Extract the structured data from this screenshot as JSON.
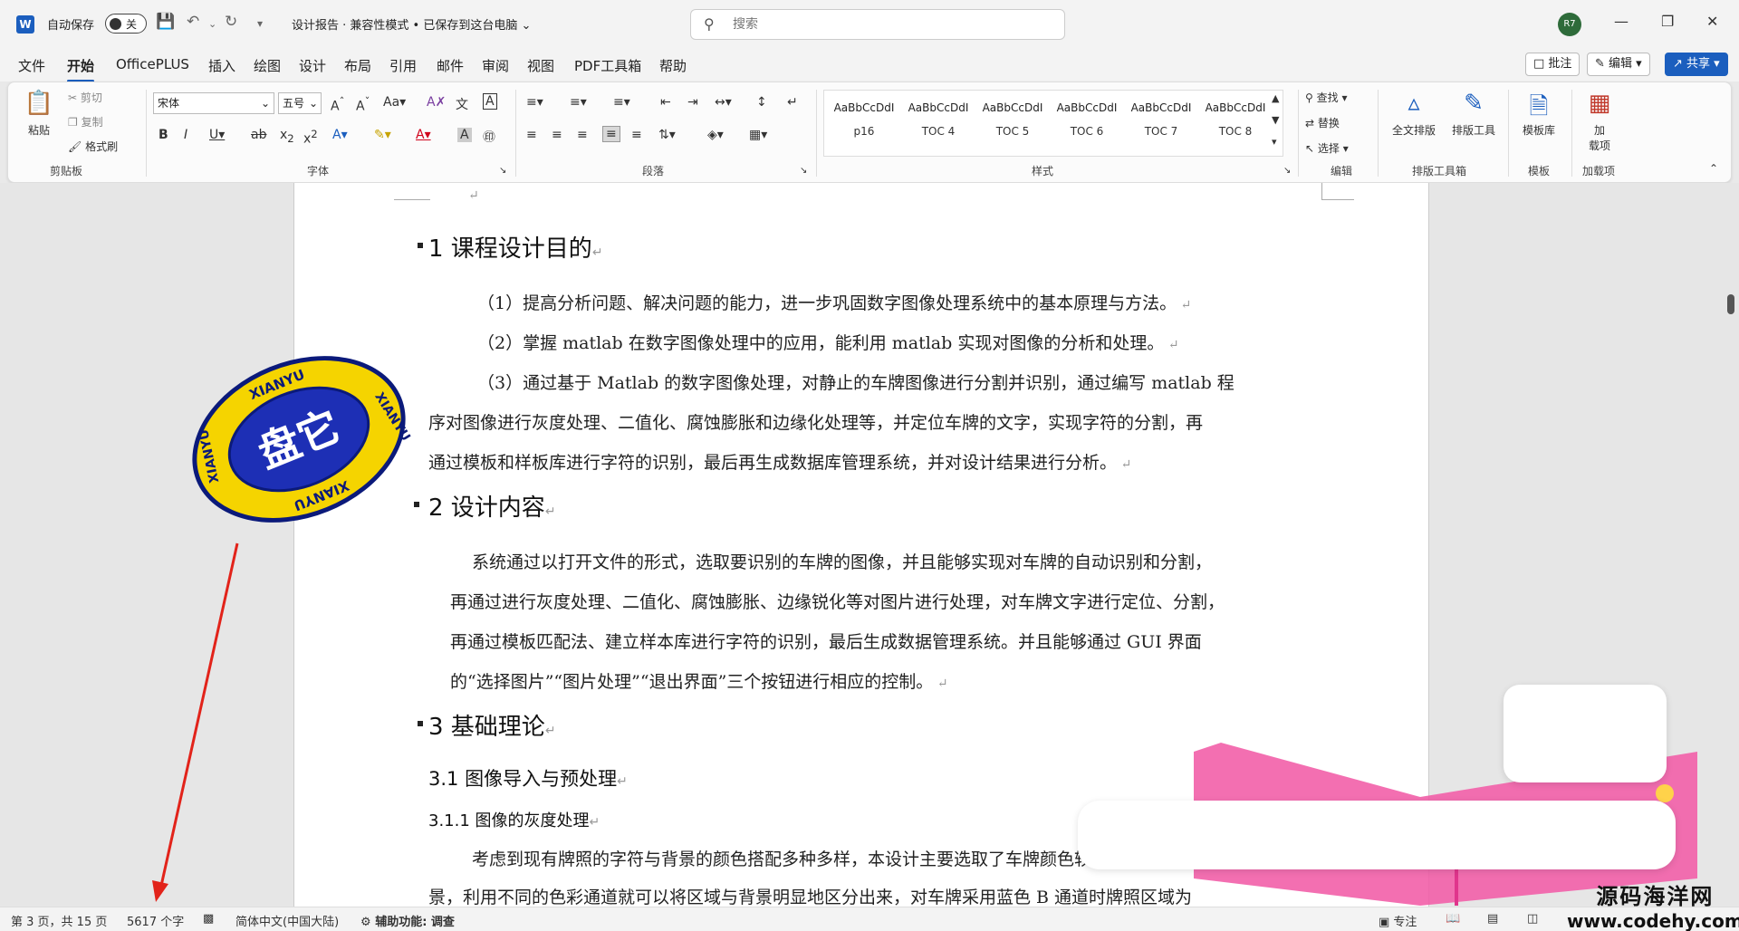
{
  "titlebar": {
    "app_icon": "W",
    "autosave_label": "自动保存",
    "autosave_state": "关",
    "doc_title": "设计报告 · 兼容性模式 • 已保存到这台电脑 ⌄",
    "search_placeholder": "搜索",
    "avatar": "R7"
  },
  "menu": {
    "tabs": [
      "文件",
      "开始",
      "OfficePLUS",
      "插入",
      "绘图",
      "设计",
      "布局",
      "引用",
      "邮件",
      "审阅",
      "视图",
      "PDF工具箱",
      "帮助"
    ],
    "active": "开始",
    "comment_label": "批注",
    "edit_label": "编辑",
    "share_label": "共享"
  },
  "ribbon": {
    "clipboard": {
      "paste": "粘贴",
      "cut": "剪切",
      "copy": "复制",
      "format_painter": "格式刷",
      "group": "剪贴板"
    },
    "font": {
      "font_name": "宋体",
      "font_size": "五号",
      "group": "字体"
    },
    "paragraph": {
      "group": "段落"
    },
    "styles": {
      "items": [
        {
          "sample": "AaBbCcDdI",
          "name": "p16"
        },
        {
          "sample": "AaBbCcDdI",
          "name": "TOC 4"
        },
        {
          "sample": "AaBbCcDdI",
          "name": "TOC 5"
        },
        {
          "sample": "AaBbCcDdI",
          "name": "TOC 6"
        },
        {
          "sample": "AaBbCcDdI",
          "name": "TOC 7"
        },
        {
          "sample": "AaBbCcDdI",
          "name": "TOC 8"
        }
      ],
      "group": "样式"
    },
    "editing": {
      "find": "查找",
      "replace": "替换",
      "select": "选择",
      "group": "编辑"
    },
    "layout_tools": {
      "full_layout": "全文排版",
      "layout_tool": "排版工具",
      "group": "排版工具箱"
    },
    "templates": {
      "template_lib": "模板库",
      "group": "模板"
    },
    "addins": {
      "addin_line1": "加",
      "addin_line2": "载项",
      "group": "加载项"
    }
  },
  "document": {
    "h1_1": "1 课程设计目的",
    "p1_1": "（1）提高分析问题、解决问题的能力，进一步巩固数字图像处理系统中的基本原理与方法。",
    "p1_2": "（2）掌握 matlab 在数字图像处理中的应用，能利用 matlab 实现对图像的分析和处理。",
    "p1_3a": "（3）通过基于 Matlab 的数字图像处理，对静止的车牌图像进行分割并识别，通过编写 matlab 程",
    "p1_3b": "序对图像进行灰度处理、二值化、腐蚀膨胀和边缘化处理等，并定位车牌的文字，实现字符的分割，再",
    "p1_3c": "通过模板和样板库进行字符的识别，最后再生成数据库管理系统，并对设计结果进行分析。",
    "h1_2": "2 设计内容",
    "p2_a": "系统通过以打开文件的形式，选取要识别的车牌的图像，并且能够实现对车牌的自动识别和分割，",
    "p2_b": "再通过进行灰度处理、二值化、腐蚀膨胀、边缘锐化等对图片进行处理，对车牌文字进行定位、分割，",
    "p2_c": "再通过模板匹配法、建立样本库进行字符的识别，最后生成数据管理系统。并且能够通过 GUI 界面",
    "p2_d": "的“选择图片”“图片处理”“退出界面”三个按钮进行相应的控制。",
    "h1_3": "3  基础理论",
    "h2_31": "3.1  图像导入与预处理",
    "h3_311": "3.1.1  图像的灰度处理",
    "p3_a": "考虑到现有牌照的字符与背景的颜色搭配多种多样，本设计主要选取了车牌颜色较普遍的蓝",
    "p3_b": "景，利用不同的色彩通道就可以将区域与背景明显地区分出来，对车牌采用蓝色 B 通道时牌照区域为"
  },
  "seal": {
    "center_text": "盘它",
    "ring_text": "XIANYU",
    "colors": {
      "ring": "#f5d400",
      "inner": "#1d2fb5",
      "border": "#0b1a7a"
    }
  },
  "statusbar": {
    "page": "第 3 页，共 15 页",
    "words": "5617 个字",
    "language": "简体中文(中国大陆)",
    "accessibility": "辅助功能: 调查",
    "focus": "专注"
  },
  "site_mark": {
    "cn": "源码海洋网",
    "url": "www.codehy.com"
  },
  "colors": {
    "accent": "#1b5ebe",
    "arrow": "#e2231a",
    "pink": "#f25fa8"
  }
}
